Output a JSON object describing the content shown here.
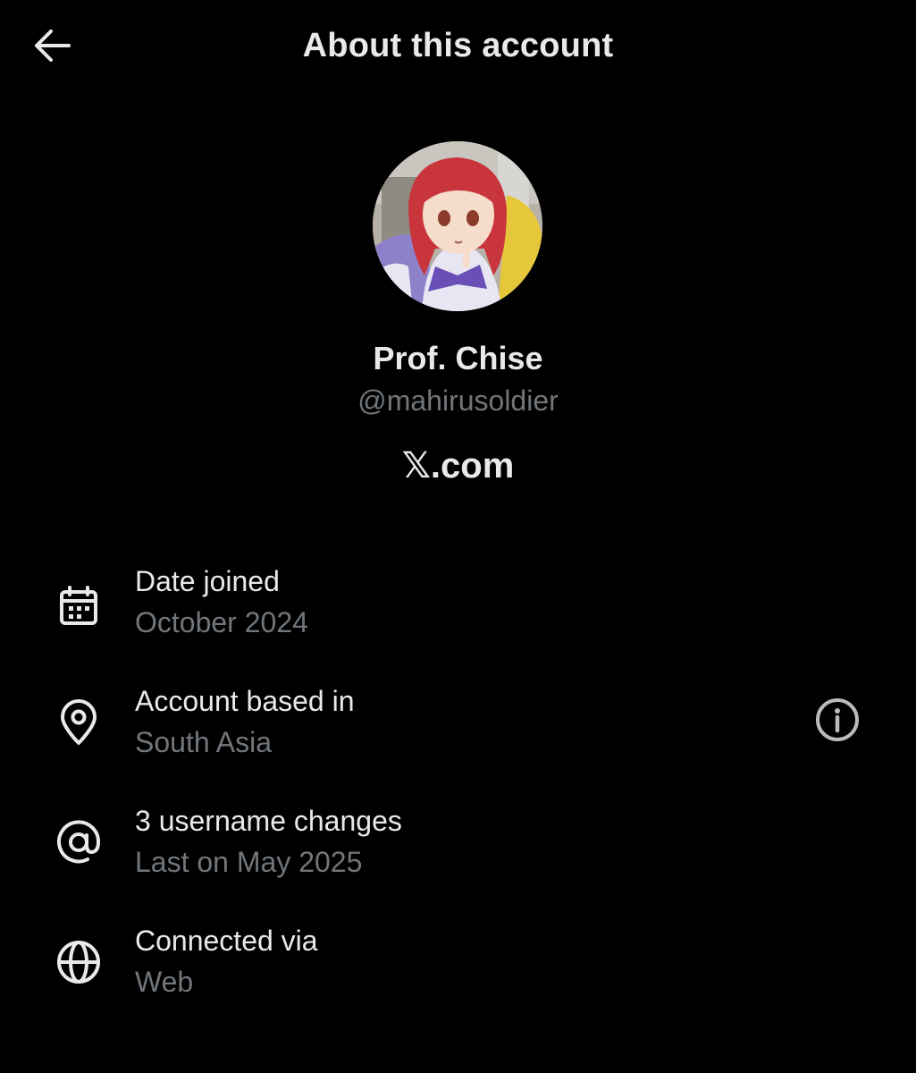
{
  "header": {
    "title": "About this account",
    "back_icon": "arrow-left-icon"
  },
  "profile": {
    "display_name": "Prof. Chise",
    "handle": "@mahirusoldier",
    "site": "𝕏.com"
  },
  "details": [
    {
      "icon": "calendar-icon",
      "title": "Date joined",
      "value": "October 2024"
    },
    {
      "icon": "location-pin-icon",
      "title": "Account based in",
      "value": "South Asia",
      "action_icon": "info-icon"
    },
    {
      "icon": "at-sign-icon",
      "title": "3 username changes",
      "value": "Last on May 2025"
    },
    {
      "icon": "globe-icon",
      "title": "Connected via",
      "value": "Web"
    }
  ],
  "colors": {
    "background": "#000000",
    "primary_text": "#e7e9ea",
    "secondary_text": "#71767b"
  }
}
